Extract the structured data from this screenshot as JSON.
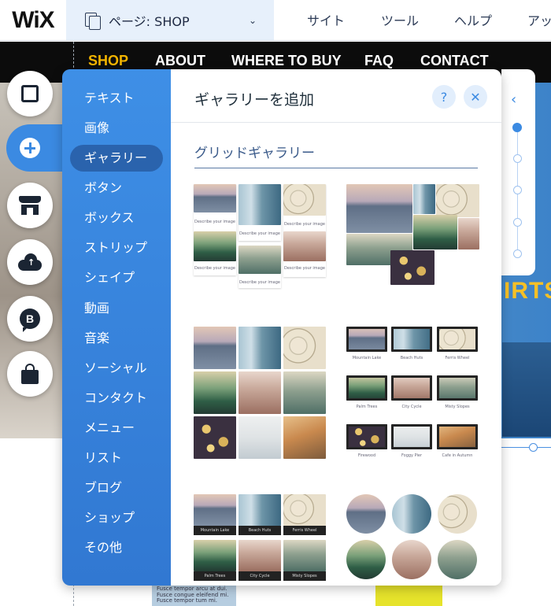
{
  "app": {
    "logo": "WiX"
  },
  "page_selector": {
    "label": "ページ: SHOP"
  },
  "top_menu": [
    "サイト",
    "ツール",
    "ヘルプ",
    "アッ"
  ],
  "site_nav": [
    "SHOP",
    "ABOUT",
    "WHERE TO BUY",
    "FAQ",
    "CONTACT"
  ],
  "hero_text": "IRTS",
  "footer_snippet": "Fusce tempor arcu at dui. Fusce congue eleifend mi. Fusce tempor tum mi.",
  "rail": [
    {
      "name": "background-square-icon"
    },
    {
      "name": "add-plus-icon",
      "active": true
    },
    {
      "name": "store-icon"
    },
    {
      "name": "upload-cloud-icon"
    },
    {
      "name": "blog-bubble-icon"
    },
    {
      "name": "shopping-bag-icon"
    }
  ],
  "panel": {
    "title": "ギャラリーを追加",
    "help": "?",
    "close": "✕",
    "categories": [
      "テキスト",
      "画像",
      "ギャラリー",
      "ボタン",
      "ボックス",
      "ストリップ",
      "シェイプ",
      "動画",
      "音楽",
      "ソーシャル",
      "コンタクト",
      "メニュー",
      "リスト",
      "ブログ",
      "ショップ",
      "その他"
    ],
    "selected_category": "ギャラリー",
    "section_title": "グリッドギャラリー",
    "captions": {
      "describe": "Describe your image",
      "mountain_lake": "Mountain Lake",
      "beach_huts": "Beach Huts",
      "ferris_wheel": "Ferris Wheel",
      "palm_trees": "Palm Trees",
      "city_cycle": "City Cycle",
      "misty_slopes": "Misty Slopes",
      "firewood": "Firewood",
      "foggy_pier": "Foggy Pier",
      "cafe_in_autumn": "Cafe in Autumn"
    }
  },
  "scroller": {
    "chevron": "‹",
    "positions": 5,
    "current": 1
  }
}
